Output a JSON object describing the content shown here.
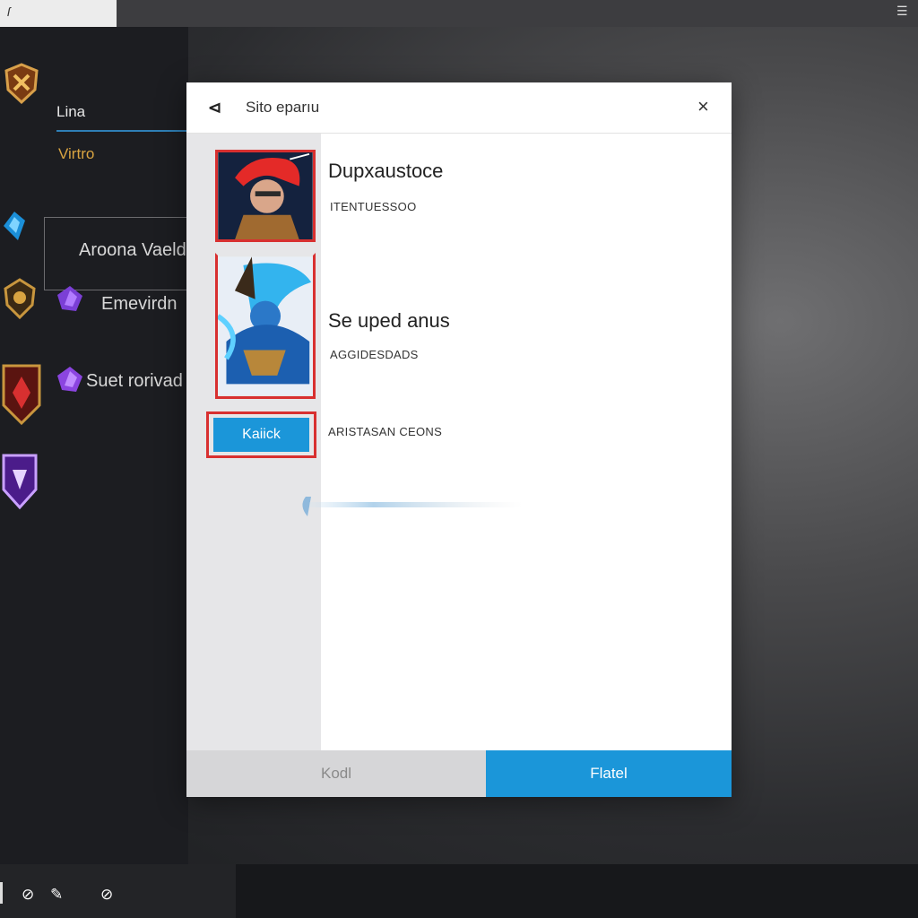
{
  "topbar": {
    "left_icon": "ſ",
    "right_icon": "☰"
  },
  "sidebar": {
    "user_name": "Lina",
    "user_rank": "Virtro",
    "items": [
      {
        "label": "Aroona Vaeld",
        "icon": "blue-crest-icon"
      },
      {
        "label": "Emevirdn",
        "icon": "gold-crest-icon"
      },
      {
        "label": "Suet rorivad",
        "icon": "red-crest-icon"
      },
      {
        "label": "",
        "icon": "purple-crest-icon"
      }
    ]
  },
  "modal": {
    "logo": "⊲",
    "title": "Sito eparıu",
    "close": "×",
    "items": [
      {
        "title": "Dupxaustoce",
        "subtitle": "ITENTUESSOO"
      },
      {
        "title": "Se uped anus",
        "subtitle": "AGGIDESDADS"
      }
    ],
    "kick_button": "Kaiick",
    "kick_caption": "ARISTASAN CEONS",
    "footer_cancel": "Kodl",
    "footer_confirm": "Flatel"
  },
  "colors": {
    "accent": "#1b96d9",
    "highlight": "#d83030",
    "sidebar_bg": "#1c1d21"
  }
}
